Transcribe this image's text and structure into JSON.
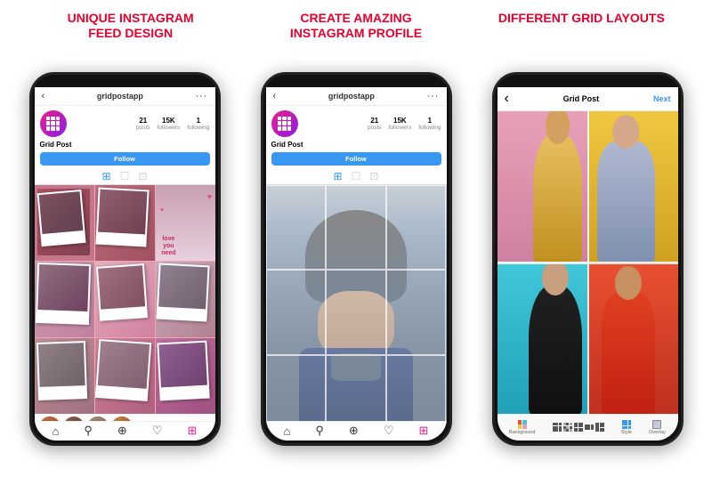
{
  "header": {
    "col1_line1": "UNIQUE INSTAGRAM",
    "col1_line2": "FEED DESIGN",
    "col2_line1": "CREATE AMAZING",
    "col2_line2": "INSTAGRAM PROFILE",
    "col3_line1": "DIFFERENT GRID LAYOUTS"
  },
  "phone1": {
    "username": "gridpostapp",
    "posts": "21",
    "posts_label": "posts",
    "followers": "15K",
    "followers_label": "followers",
    "following": "1",
    "following_label": "following",
    "profile_name": "Grid Post",
    "follow_button": "Follow"
  },
  "phone2": {
    "username": "gridpostapp",
    "posts": "21",
    "posts_label": "posts",
    "followers": "15K",
    "followers_label": "followers",
    "following": "1",
    "following_label": "following",
    "profile_name": "Grid Post",
    "follow_button": "Follow"
  },
  "phone3": {
    "title": "Grid Post",
    "next_button": "Next",
    "tools": {
      "background_label": "Background",
      "style_label": "Style",
      "overlay_label": "Overlay"
    }
  }
}
